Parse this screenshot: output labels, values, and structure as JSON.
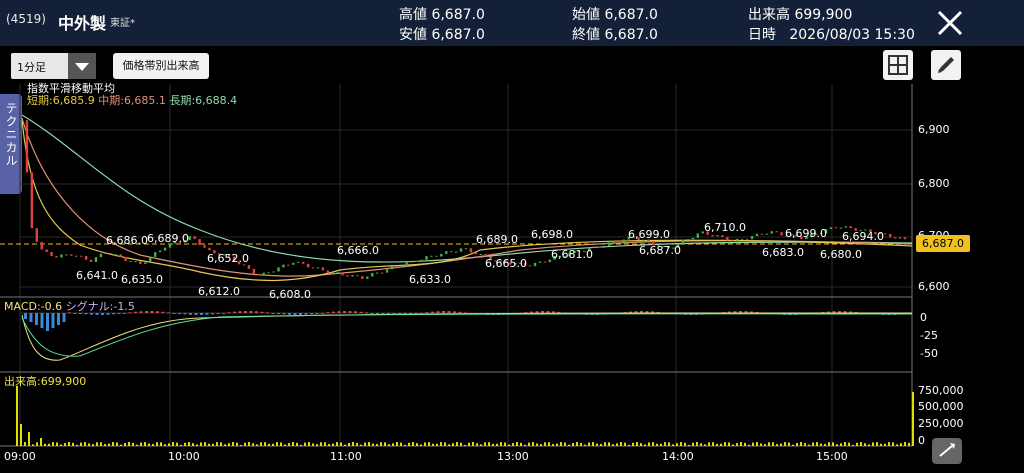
{
  "header": {
    "code": "(4519)",
    "name": "中外製",
    "exchange": "東証*",
    "high_label": "高値",
    "high": "6,687.0",
    "low_label": "安値",
    "low": "6,687.0",
    "open_label": "始値",
    "open": "6,687.0",
    "close_label": "終値",
    "close": "6,687.0",
    "volume_label": "出来高",
    "volume": "699,900",
    "datetime_label": "日時",
    "datetime": "2026/08/03 15:30"
  },
  "controls": {
    "interval": "1分足",
    "volume_by_price": "価格帯別出来高",
    "technical_tab": "テクニカル"
  },
  "legend": {
    "ema_title": "指数平滑移動平均",
    "short_label": "短期",
    "short_value": "6,685.9",
    "mid_label": "中期",
    "mid_value": "6,685.1",
    "long_label": "長期",
    "long_value": "6,688.4",
    "macd_label": "MACD",
    "macd_value": "-0.6",
    "signal_label": "シグナル",
    "signal_value": "-1.5",
    "volume_label": "出来高",
    "volume_value": "699,900"
  },
  "colors": {
    "header_bg": "#142037",
    "short_ema": "#e6c84a",
    "mid_ema": "#e0907a",
    "long_ema": "#90d8b0",
    "price_line": "#f0c020",
    "volume_bar": "#e0e000"
  },
  "chart_data": {
    "type": "line",
    "x_ticks": [
      "09:00",
      "10:00",
      "11:00",
      "13:00",
      "14:00",
      "15:00"
    ],
    "price_axis": [
      "6,900",
      "6,800",
      "6,700",
      "6,600"
    ],
    "current_price": "6,687.0",
    "price_labels": [
      "6,686.0",
      "6,689.0",
      "6,641.0",
      "6,635.0",
      "6,652.0",
      "6,612.0",
      "6,608.0",
      "6,666.0",
      "6,633.0",
      "6,689.0",
      "6,665.0",
      "6,698.0",
      "6,681.0",
      "6,699.0",
      "6,687.0",
      "6,710.0",
      "6,699.0",
      "6,683.0",
      "6,694.0",
      "6,680.0"
    ],
    "macd_axis": [
      "0",
      "-25",
      "-50"
    ],
    "volume_axis": [
      "750,000",
      "500,000",
      "250,000",
      "0"
    ],
    "price_series": {
      "x": [
        0,
        3,
        6,
        10,
        15,
        20,
        25,
        30,
        35,
        42,
        50,
        55,
        60,
        70,
        80,
        90,
        100,
        110,
        120,
        130,
        140,
        150,
        160,
        170,
        180,
        190,
        200,
        210,
        220,
        230,
        240,
        250,
        260
      ],
      "y": [
        6920,
        6700,
        6660,
        6650,
        6655,
        6641,
        6660,
        6645,
        6635,
        6670,
        6689,
        6660,
        6652,
        6612,
        6640,
        6620,
        6608,
        6630,
        6650,
        6666,
        6640,
        6633,
        6655,
        6670,
        6689,
        6665,
        6698,
        6681,
        6699,
        6687,
        6710,
        6699,
        6683
      ]
    },
    "ylim": [
      6580,
      6940
    ]
  }
}
